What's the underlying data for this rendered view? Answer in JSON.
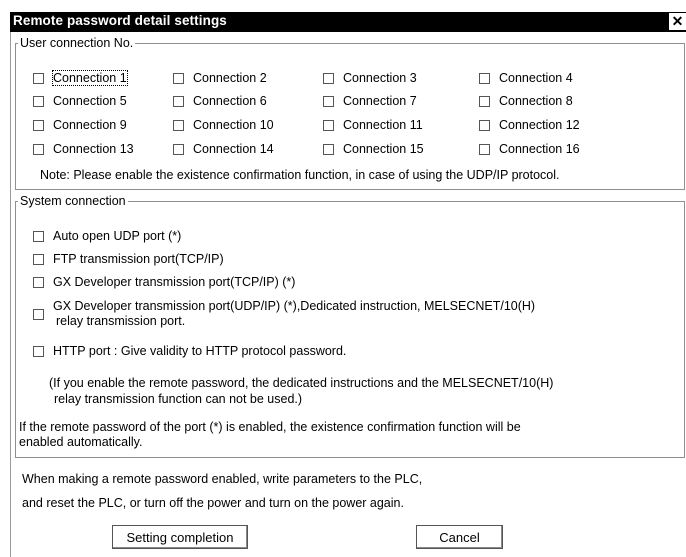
{
  "window": {
    "title": "Remote password detail settings",
    "close_glyph": "✕"
  },
  "user_connection": {
    "legend": "User connection No.",
    "connections": [
      "Connection 1",
      "Connection 2",
      "Connection 3",
      "Connection 4",
      "Connection 5",
      "Connection 6",
      "Connection 7",
      "Connection 8",
      "Connection 9",
      "Connection 10",
      "Connection 11",
      "Connection 12",
      "Connection 13",
      "Connection 14",
      "Connection 15",
      "Connection 16"
    ],
    "note": "Note: Please enable the existence confirmation function, in case of using the UDP/IP protocol."
  },
  "system_connection": {
    "legend": "System connection",
    "options": {
      "auto_open_udp": "Auto open UDP port (*)",
      "ftp": "FTP transmission port(TCP/IP)",
      "gx_tcp": "GX Developer transmission port(TCP/IP) (*)",
      "gx_udp_line1": "GX Developer transmission port(UDP/IP) (*),Dedicated instruction, MELSECNET/10(H)",
      "gx_udp_line2": "relay transmission port.",
      "http": "HTTP port : Give validity to HTTP protocol password."
    },
    "info_line1": "(If you enable the remote password, the dedicated instructions and the MELSECNET/10(H)",
    "info_line2": "relay transmission function can not be used.)",
    "asterisk_line1": "If the remote password of the port (*) is enabled, the existence confirmation function will be",
    "asterisk_line2": "enabled automatically."
  },
  "footer": {
    "line1": "When making a remote password enabled, write parameters to the PLC,",
    "line2": "and reset the PLC, or turn off the power and turn on the power again."
  },
  "buttons": {
    "setting_completion": "Setting completion",
    "cancel": "Cancel"
  }
}
